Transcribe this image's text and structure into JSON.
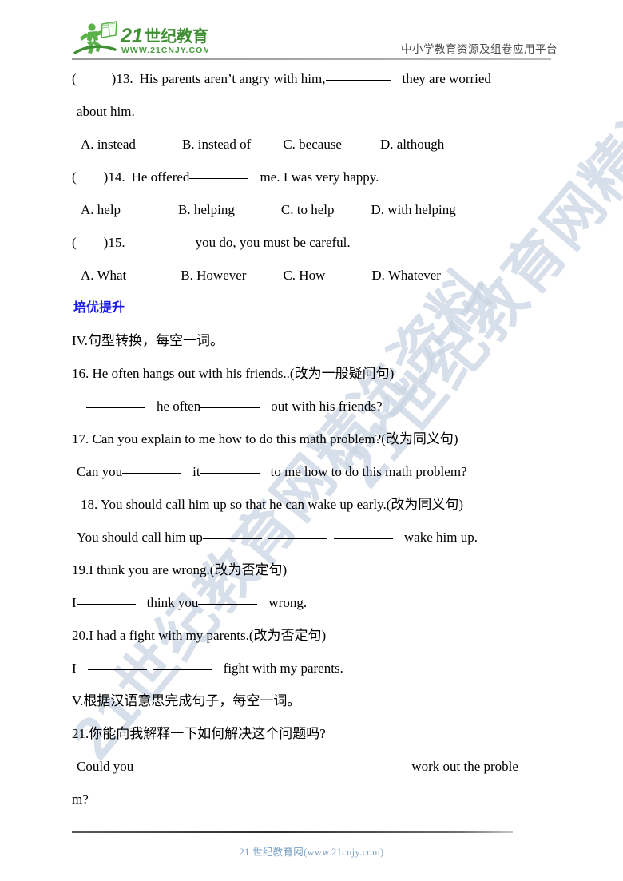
{
  "header": {
    "logo_title": "21世纪教育",
    "logo_url": "WWW.21CNJY.COM",
    "slogan": "中小学教育资源及组卷应用平台"
  },
  "watermark": {
    "text_upper": "21世纪教育网精选资料",
    "text_lower": "21世纪教育网精选资料"
  },
  "questions": {
    "q13": {
      "marker": "(",
      "marker_close": ")13.",
      "stem_part1": "His parents aren’t angry with him,",
      "stem_part2": "they are worried",
      "stem_wrap": "about him.",
      "options": [
        "A. instead",
        "B. instead of",
        "C. because",
        "D. although"
      ]
    },
    "q14": {
      "marker": "(",
      "marker_close": ")14.",
      "stem_part1": "He offered",
      "stem_part2": "me. I was very happy.",
      "options": [
        "A. help",
        "B. helping",
        "C. to help",
        "D. with helping"
      ]
    },
    "q15": {
      "marker": "(",
      "marker_close": ")15.",
      "stem_part1": "",
      "stem_part2": "you do, you must be careful.",
      "options": [
        "A. What",
        "B. However",
        "C. How",
        "D. Whatever"
      ]
    }
  },
  "sections": {
    "enrichment_heading": "培优提升",
    "part4_title": "IV.句型转换，每空一词。",
    "part5_title": "V.根据汉语意思完成句子，每空一词。"
  },
  "transform": {
    "q16": {
      "prompt": "16. He often hangs out with his friends..(改为一般疑问句)",
      "answer_a": "he often",
      "answer_b": "out with his friends?"
    },
    "q17": {
      "prompt": "17. Can you explain to me how to do this math problem?(改为同义句)",
      "answer_a": "Can you",
      "answer_b": "it",
      "answer_c": "to me how to do this math problem?"
    },
    "q18": {
      "prompt": "18. You should call him up so that he can wake up early.(改为同义句)",
      "answer_a": "You should call him up",
      "answer_b": "wake him up."
    },
    "q19": {
      "prompt": "19.I think you are wrong.(改为否定句)",
      "answer_a": "I",
      "answer_b": "think you",
      "answer_c": "wrong."
    },
    "q20": {
      "prompt": "20.I had a fight with my parents.(改为否定句)",
      "answer_a": "I",
      "answer_b": "fight with my parents."
    }
  },
  "translate": {
    "q21": {
      "prompt": "21.你能向我解释一下如何解决这个问题吗?",
      "answer_a": "Could you",
      "answer_b": "work out the proble",
      "answer_wrap": "m?"
    }
  },
  "footer": {
    "text": "21 世纪教育网(www.21cnjy.com)"
  },
  "colors": {
    "heading_blue": "#1a1aec",
    "footer_blue": "#7aa1c6",
    "logo_green": "#4a9d3f",
    "watermark": "#c9d4e2"
  }
}
